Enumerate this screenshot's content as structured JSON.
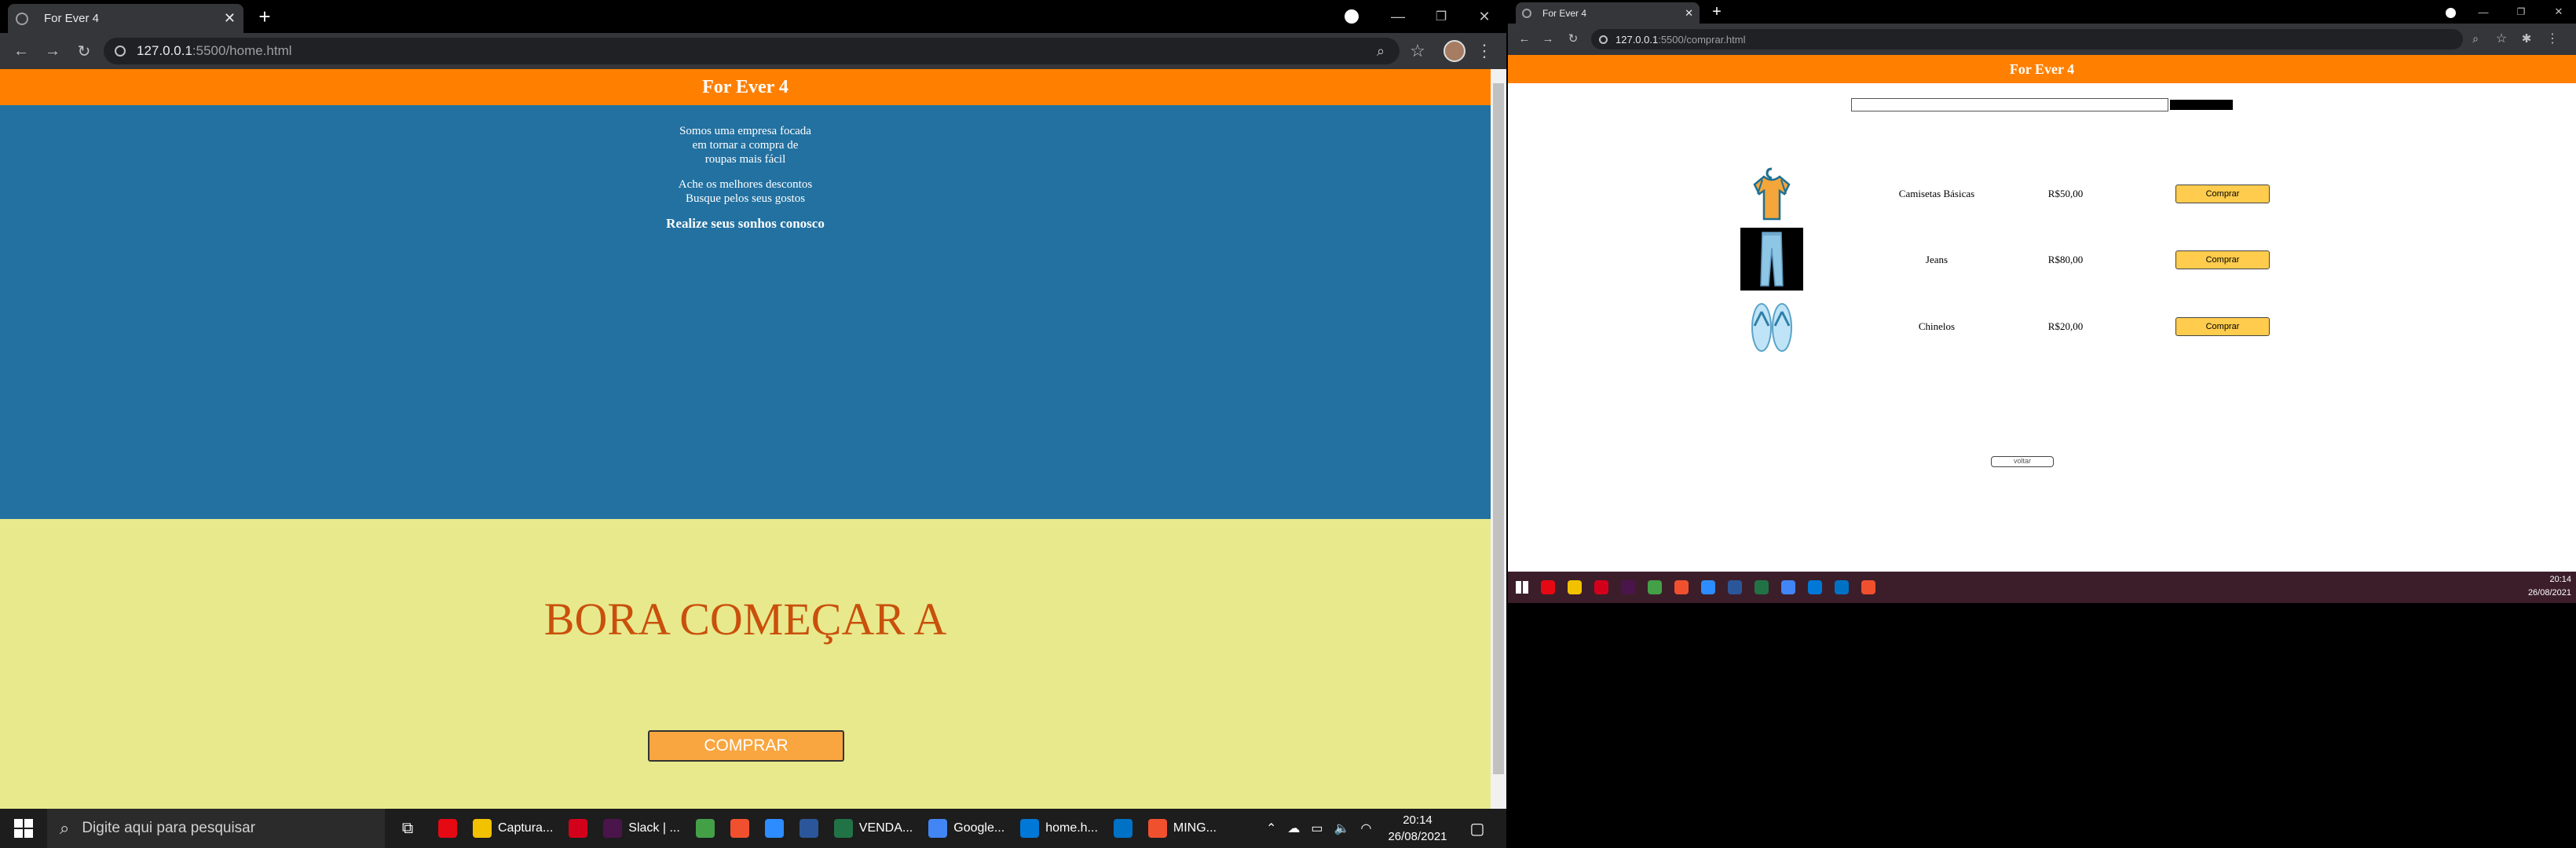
{
  "left_window": {
    "tab_title": "For Ever 4",
    "url_host": "127.0.0.1",
    "url_path": ":5500/home.html",
    "header_title": "For Ever 4",
    "hero_lines_1": [
      "Somos uma empresa focada",
      "em tornar a compra de",
      "roupas mais fácil"
    ],
    "hero_lines_2": [
      "Ache os melhores descontos",
      "Busque pelos seus gostos"
    ],
    "hero_strong": "Realize seus sonhos conosco",
    "headline": "BORA COMEÇAR A",
    "cta_label": "COMPRAR"
  },
  "right_window": {
    "tab_title": "For Ever 4",
    "url_host": "127.0.0.1",
    "url_path": ":5500/comprar.html",
    "header_title": "For Ever 4",
    "products": [
      {
        "name": "Camisetas Básicas",
        "price": "R$50,00",
        "button": "Comprar",
        "icon": "tshirt-icon"
      },
      {
        "name": "Jeans",
        "price": "R$80,00",
        "button": "Comprar",
        "icon": "jeans-icon"
      },
      {
        "name": "Chinelos",
        "price": "R$20,00",
        "button": "Comprar",
        "icon": "flip-flops-icon"
      }
    ],
    "back_label": "voltar",
    "clock_time": "20:14",
    "clock_date": "26/08/2021"
  },
  "taskbar": {
    "search_placeholder": "Digite aqui para pesquisar",
    "apps": [
      {
        "label": "",
        "color": "#e50914",
        "name": "netflix-app"
      },
      {
        "label": "Captura...",
        "color": "#f2c200",
        "name": "explorer-app"
      },
      {
        "label": "",
        "color": "#d3001b",
        "name": "opera-app"
      },
      {
        "label": "Slack | ...",
        "color": "#4a154b",
        "name": "slack-app"
      },
      {
        "label": "",
        "color": "#43a047",
        "name": "node-app"
      },
      {
        "label": "",
        "color": "#f1502f",
        "name": "git-app"
      },
      {
        "label": "",
        "color": "#2d8cff",
        "name": "zoom-app"
      },
      {
        "label": "",
        "color": "#2b579a",
        "name": "word-app"
      },
      {
        "label": "VENDA...",
        "color": "#217346",
        "name": "excel-app"
      },
      {
        "label": "Google...",
        "color": "#4285f4",
        "name": "chrome-app"
      },
      {
        "label": "home.h...",
        "color": "#0078d7",
        "name": "vscode-app"
      },
      {
        "label": "",
        "color": "#0072c6",
        "name": "mail-app"
      },
      {
        "label": "MING...",
        "color": "#f1502f",
        "name": "mingw-app"
      }
    ],
    "clock_time": "20:14",
    "clock_date": "26/08/2021"
  },
  "colors": {
    "orange": "#ff8000",
    "hero_blue": "#2271a1",
    "yellow_bg": "#e8e98c",
    "headline": "#c9500c",
    "button": "#f9a640"
  }
}
